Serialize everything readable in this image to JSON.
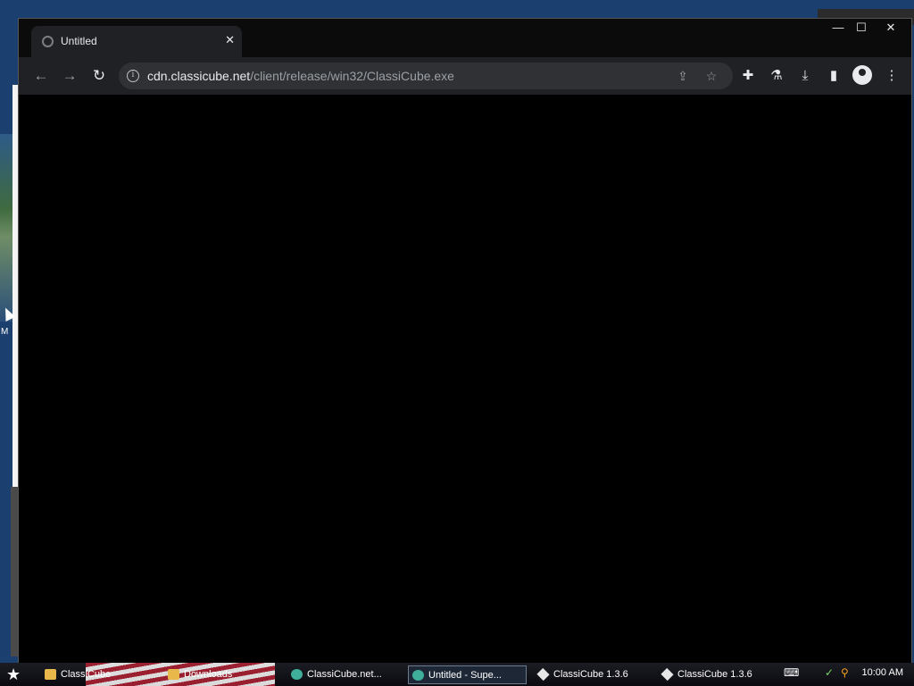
{
  "desktop": {
    "label": "M"
  },
  "tab": {
    "title": "Untitled",
    "close": "✕"
  },
  "window_controls": {
    "minimize": "—",
    "maximize": "☐",
    "close": "✕"
  },
  "toolbar": {
    "back": "←",
    "forward": "→",
    "reload": "↻",
    "url_host": "cdn.classicube.net",
    "url_path": "/client/release/win32/ClassiCube.exe",
    "info": "i",
    "share": "⇪",
    "bookmark": "☆",
    "extensions": "✚",
    "labs": "⚗",
    "download": "⤓",
    "sidepanel": "▮",
    "menu": "⋮"
  },
  "taskbar": {
    "start": "★",
    "items": [
      {
        "label": "ClassiCube",
        "icon": "folder-icon"
      },
      {
        "label": "Downloads",
        "icon": "folder-icon"
      },
      {
        "label": "ClassiCube.net...",
        "icon": "browser-icon"
      },
      {
        "label": "Untitled - Supe...",
        "icon": "browser-icon",
        "active": true
      },
      {
        "label": "ClassiCube 1.3.6",
        "icon": "cube-icon"
      },
      {
        "label": "ClassiCube 1.3.6",
        "icon": "cube-icon"
      }
    ],
    "keyboard": "⌨",
    "search": "⚲",
    "clock": "10:00 AM"
  }
}
